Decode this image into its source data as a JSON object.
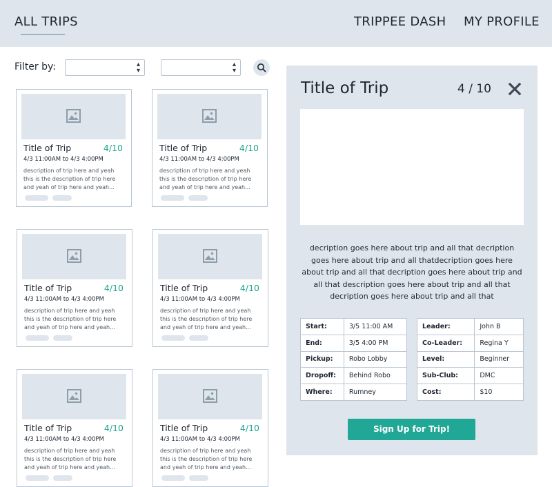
{
  "nav": {
    "all_trips": "ALL TRIPS",
    "trippee_dash": "TRIPPEE DASH",
    "my_profile": "MY PROFILE"
  },
  "filter": {
    "label": "Filter by:",
    "select1_value": "",
    "select2_value": ""
  },
  "cards": [
    {
      "title": "Title of Trip",
      "count": "4/10",
      "date": "4/3 11:00AM to 4/3 4:00PM",
      "desc": "description of trip here and yeah this is the description of trip here and yeah of trip here and yeah..."
    },
    {
      "title": "Title of Trip",
      "count": "4/10",
      "date": "4/3 11:00AM to 4/3 4:00PM",
      "desc": "description of trip here and yeah this is the description of trip here and yeah of trip here and yeah..."
    },
    {
      "title": "Title of Trip",
      "count": "4/10",
      "date": "4/3 11:00AM to 4/3 4:00PM",
      "desc": "description of trip here and yeah this is the description of trip here and yeah of trip here and yeah..."
    },
    {
      "title": "Title of Trip",
      "count": "4/10",
      "date": "4/3 11:00AM to 4/3 4:00PM",
      "desc": "description of trip here and yeah this is the description of trip here and yeah of trip here and yeah..."
    },
    {
      "title": "Title of Trip",
      "count": "4/10",
      "date": "4/3 11:00AM to 4/3 4:00PM",
      "desc": "description of trip here and yeah this is the description of trip here and yeah of trip here and yeah..."
    },
    {
      "title": "Title of Trip",
      "count": "4/10",
      "date": "4/3 11:00AM to 4/3 4:00PM",
      "desc": "description of trip here and yeah this is the description of trip here and yeah of trip here and yeah..."
    }
  ],
  "detail": {
    "title": "Title of Trip",
    "count": "4 / 10",
    "description": "decription goes here about trip and all that decription goes here about trip and all thatdecription goes here about trip and all that decription goes here about trip and all that description goes here about trip and all that decription goes here about trip and all that",
    "left_table": [
      {
        "key": "Start:",
        "value": "3/5 11:00 AM"
      },
      {
        "key": "End:",
        "value": "3/5 4:00 PM"
      },
      {
        "key": "Pickup:",
        "value": "Robo Lobby"
      },
      {
        "key": "Dropoff:",
        "value": "Behind Robo"
      },
      {
        "key": "Where:",
        "value": "Rumney"
      }
    ],
    "right_table": [
      {
        "key": "Leader:",
        "value": "John B"
      },
      {
        "key": "Co-Leader:",
        "value": "Regina Y"
      },
      {
        "key": "Level:",
        "value": "Beginner"
      },
      {
        "key": "Sub-Club:",
        "value": "DMC"
      },
      {
        "key": "Cost:",
        "value": "$10"
      }
    ],
    "signup_label": "Sign Up for Trip!"
  },
  "colors": {
    "header_bg": "#dfe5ec",
    "accent_green": "#1ea58f",
    "button_green": "#21a795",
    "border": "#b7c5d2"
  }
}
